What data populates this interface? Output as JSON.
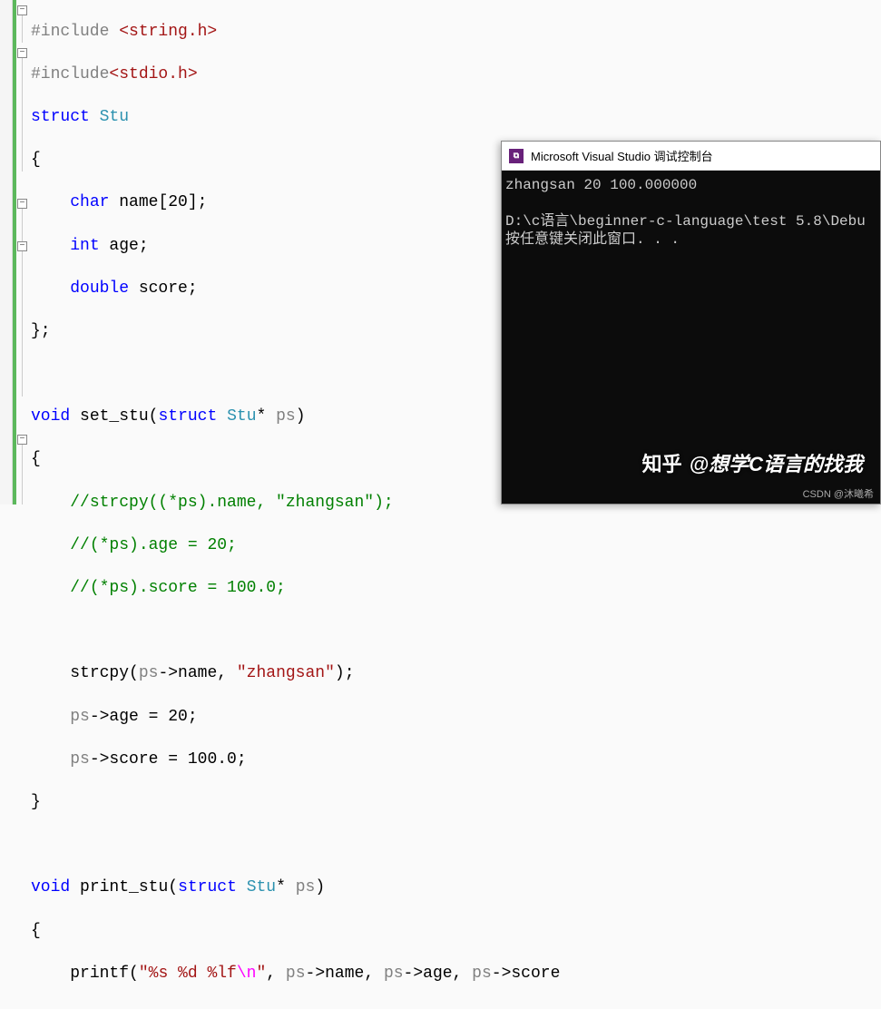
{
  "code": {
    "l1_pre": "#include ",
    "l1_inc": "<string.h>",
    "l2_pre": "#include",
    "l2_inc": "<stdio.h>",
    "kw_struct": "struct",
    "kw_void": "void",
    "kw_char": "char",
    "kw_int": "int",
    "kw_double": "double",
    "type_stu": "Stu",
    "fn_set": "set_stu",
    "fn_print": "print_stu",
    "param_ps": "ps",
    "star": "*",
    "brace_open": "{",
    "brace_close": "}",
    "brace_close_semi": "};",
    "field_name_decl": " name[20];",
    "field_age_decl": " age;",
    "field_score_decl": " score;",
    "open_paren": "(",
    "close_paren": ")",
    "c1": "//strcpy((*ps).name, \"zhangsan\");",
    "c2": "//(*ps).age = 20;",
    "c3": "//(*ps).score = 100.0;",
    "l_strcpy_a": "strcpy(",
    "l_strcpy_b": "->name, ",
    "str_zhangsan": "\"zhangsan\"",
    "l_strcpy_end": ");",
    "l_age_a": "->age = 20;",
    "l_score_a": "->score = 100.0;",
    "l_printf_a": "printf(",
    "fmt_a": "\"%s %d %lf",
    "fmt_esc": "\\n",
    "fmt_b": "\"",
    "l_printf_b": ", ",
    "arrow_name": "->name, ",
    "arrow_age": "->age, ",
    "arrow_score": "->score"
  },
  "console": {
    "title": "Microsoft Visual Studio 调试控制台",
    "icon": "⧉",
    "out1": "zhangsan 20 100.000000",
    "out2": "",
    "out3": "D:\\c语言\\beginner-c-language\\test 5.8\\Debu",
    "out4": "按任意键关闭此窗口. . ."
  },
  "watermark": {
    "logo": "知乎",
    "text": "@想学C语言的找我"
  },
  "csdn": "CSDN @沐曦希"
}
